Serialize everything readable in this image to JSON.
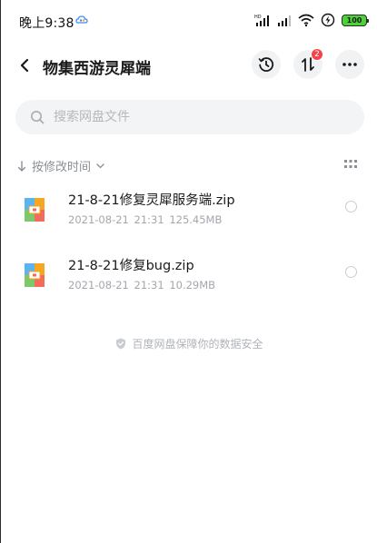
{
  "status_bar": {
    "time": "晚上9:38",
    "battery": "100"
  },
  "header": {
    "title": "物集西游灵犀端",
    "transfer_badge": "2"
  },
  "search": {
    "placeholder": "搜索网盘文件"
  },
  "sort": {
    "label": "按修改时间"
  },
  "files": [
    {
      "name": "21-8-21修复灵犀服务端.zip",
      "date": "2021-08-21",
      "time": "21:31",
      "size": "125.45MB"
    },
    {
      "name": "21-8-21修复bug.zip",
      "date": "2021-08-21",
      "time": "21:31",
      "size": "10.29MB"
    }
  ],
  "footer": {
    "note": "百度网盘保障你的数据安全"
  },
  "colors": {
    "accent_badge": "#f5424b",
    "battery": "#4cd137",
    "icon_orange": "#f5a623",
    "icon_red": "#f26b5b",
    "icon_blue": "#5bb4f0",
    "icon_green": "#7cc96b"
  }
}
